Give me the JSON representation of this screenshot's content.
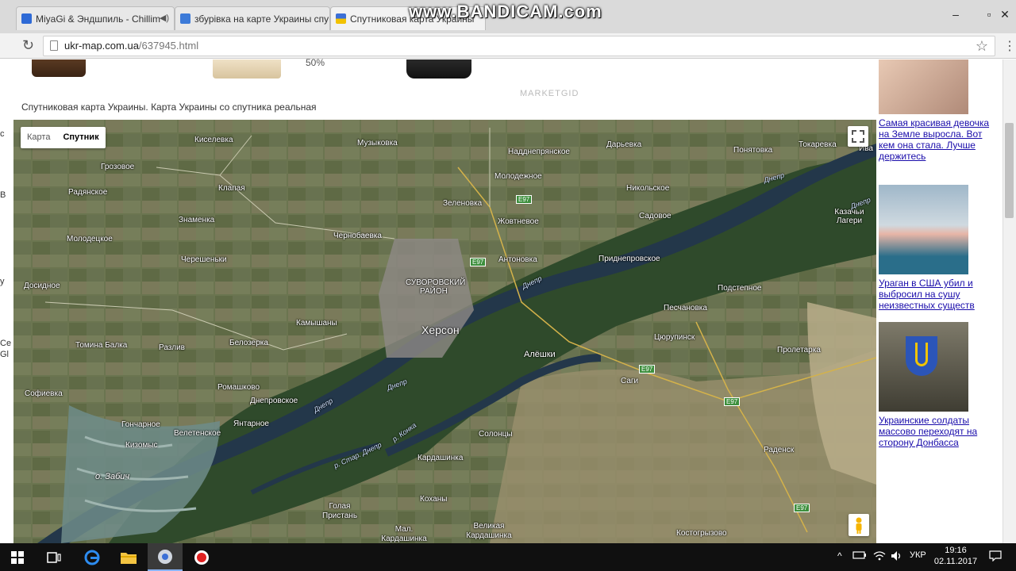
{
  "browser": {
    "tabs": [
      {
        "title": "MiyaGi & Эндшпиль - Chillim",
        "favicon_color": "#2e6ad6"
      },
      {
        "title": "збурівка на карте Украины спу",
        "favicon_color": "#3c7ad8"
      },
      {
        "title": "Спутниковая карта Украины",
        "favicon_color": "#f2c200"
      }
    ],
    "url_host": "ukr-map.com.ua",
    "url_path": "/637945.html",
    "watermark": "www.BANDICAM.com"
  },
  "page": {
    "discount": "50%",
    "marketgid": "MARKETGID",
    "caption": "Спутниковая карта Украины. Карта Украины со спутника реальная"
  },
  "map": {
    "type_buttons": [
      "Карта",
      "Спутник"
    ],
    "labels": [
      "Киселевка",
      "Музыковка",
      "Надднепрянское",
      "Дарьевка",
      "Понятовка",
      "Токаревка",
      "Ива",
      "Грозовое",
      "Клапая",
      "Молодежное",
      "Радянское",
      "Никольское",
      "Зеленовка",
      "Жовтневое",
      "Садовое",
      "Казачьи Лагери",
      "Знаменка",
      "Чернобаевка",
      "Молодецкое",
      "Антоновка",
      "Приднепровское",
      "Черешеньки",
      "Досидное",
      "Подстепное",
      "Песчановка",
      "Камышаны",
      "Херсон",
      "Томина Балка",
      "Разлив",
      "Белозерка",
      "Алёшки",
      "Цюрупинск",
      "Пролетарка",
      "Саги",
      "Ромашково",
      "Софиевка",
      "Днепровское",
      "Гончарное",
      "Янтарное",
      "Велетенское",
      "Солонцы",
      "Кизомыс",
      "Радeнск",
      "Кардашинка",
      "о. Забич",
      "Коханы",
      "Голая Пристань",
      "Мал. Кардашинка",
      "Великая Кардашинка",
      "Костогрызово"
    ],
    "district": [
      "СУВОРОВСКИЙ",
      "РАЙОН"
    ],
    "rivers": [
      "Днепр",
      "Днепр",
      "Днепр",
      "Днепр",
      "Днепр",
      "р. Конка",
      "р. Стар. Днепр"
    ],
    "road": "E97"
  },
  "sidebar_ads": [
    {
      "text": "Самая красивая девочка на Земле выросла. Вот кем она стала. Лучше держитесь"
    },
    {
      "text": "Ураган в США убил и выбросил на сушу неизвестных существ"
    },
    {
      "text": "Украинские солдаты массово переходят на сторону Донбасса"
    }
  ],
  "edge_text": [
    "с",
    "В",
    "у",
    "Се",
    "Gl"
  ],
  "taskbar": {
    "language": "УКР",
    "time": "19:16",
    "date": "02.11.2017"
  }
}
